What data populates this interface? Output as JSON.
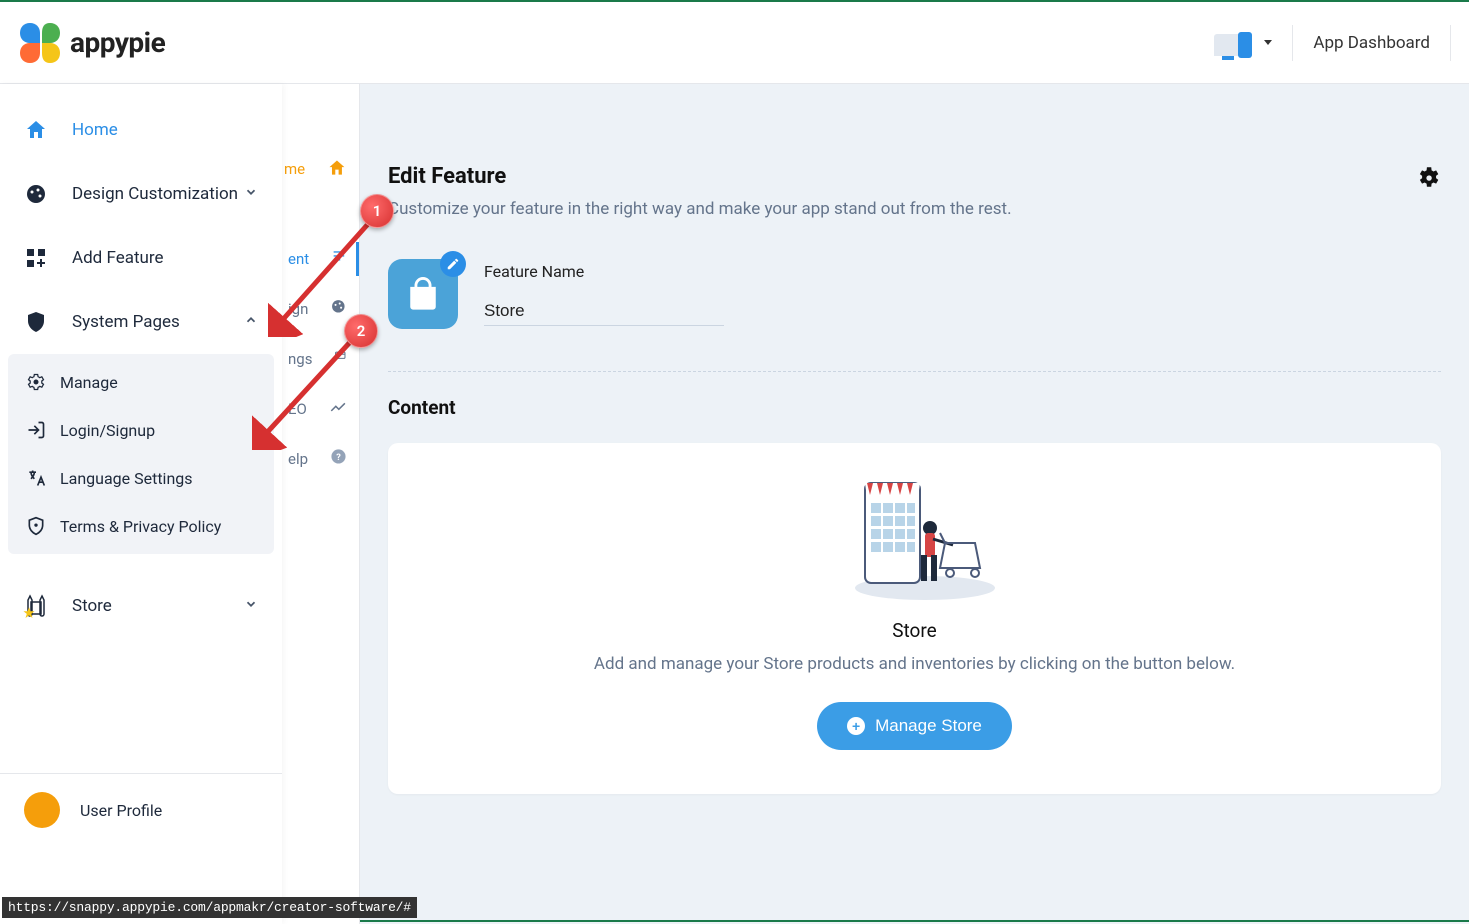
{
  "brand": "appypie",
  "topbar": {
    "app_dashboard": "App Dashboard"
  },
  "sidebar": {
    "home": "Home",
    "design": "Design Customization",
    "add_feature": "Add Feature",
    "system_pages": "System Pages",
    "system_sub": {
      "manage": "Manage",
      "login_signup": "Login/Signup",
      "language_settings": "Language Settings",
      "terms_privacy": "Terms & Privacy Policy"
    },
    "store": "Store",
    "user_profile": "User Profile"
  },
  "under_sidebar": {
    "home_tab": "me",
    "content_tab": "ent",
    "design_tab": "ign",
    "settings_tab": "ngs",
    "seo_tab": "EO",
    "help_tab": "elp"
  },
  "main": {
    "title": "Edit Feature",
    "subtitle": "Customize your feature in the right way and make your app stand out from the rest.",
    "feature_name_label": "Feature Name",
    "feature_name_value": "Store",
    "content_heading": "Content",
    "card": {
      "title": "Store",
      "description": "Add and manage your Store products and inventories by clicking on the button below.",
      "button": "Manage Store"
    }
  },
  "status_url": "https://snappy.appypie.com/appmakr/creator-software/#",
  "anno": {
    "one": "1",
    "two": "2"
  }
}
